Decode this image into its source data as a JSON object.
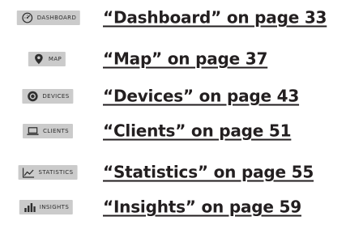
{
  "items": [
    {
      "tag_label": "DASHBOARD",
      "icon": "dashboard-gauge-icon",
      "link_text": "“Dashboard” on page 33"
    },
    {
      "tag_label": "MAP",
      "icon": "map-pin-icon",
      "link_text": "“Map” on page 37"
    },
    {
      "tag_label": "DEVICES",
      "icon": "devices-circle-icon",
      "link_text": "“Devices” on page 43"
    },
    {
      "tag_label": "CLIENTS",
      "icon": "clients-laptop-icon",
      "link_text": "“Clients” on page 51"
    },
    {
      "tag_label": "STATISTICS",
      "icon": "statistics-line-chart-icon",
      "link_text": "“Statistics” on page 55"
    },
    {
      "tag_label": "INSIGHTS",
      "icon": "insights-bar-chart-icon",
      "link_text": "“Insights” on page 59"
    }
  ],
  "colors": {
    "tag_background": "#cbcbcb",
    "tag_text": "#2e2e2e",
    "link_text": "#231f20"
  }
}
